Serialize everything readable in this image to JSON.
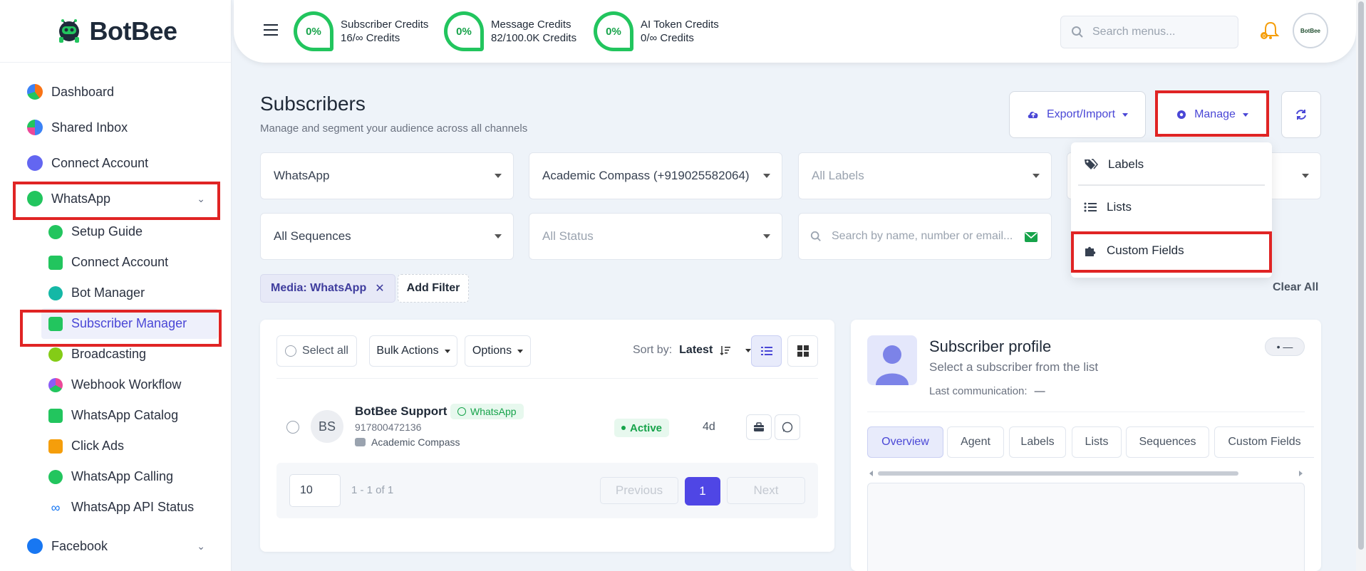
{
  "brand": {
    "name": "BotBee"
  },
  "sidebar": {
    "items": [
      {
        "label": "Dashboard",
        "color": "#f97316"
      },
      {
        "label": "Shared Inbox",
        "color": "#3b82f6"
      },
      {
        "label": "Connect Account",
        "color": "#6366f1"
      },
      {
        "label": "WhatsApp",
        "color": "#22c55e"
      }
    ],
    "whatsapp_sub": [
      {
        "label": "Setup Guide"
      },
      {
        "label": "Connect Account"
      },
      {
        "label": "Bot Manager"
      },
      {
        "label": "Subscriber Manager"
      },
      {
        "label": "Broadcasting"
      },
      {
        "label": "Webhook Workflow"
      },
      {
        "label": "WhatsApp Catalog"
      },
      {
        "label": "Click Ads"
      },
      {
        "label": "WhatsApp Calling"
      },
      {
        "label": "WhatsApp API Status"
      }
    ],
    "facebook": {
      "label": "Facebook"
    }
  },
  "topbar": {
    "credits": [
      {
        "percent": "0%",
        "title": "Subscriber Credits",
        "value": "16/∞ Credits"
      },
      {
        "percent": "0%",
        "title": "Message Credits",
        "value": "82/100.0K Credits"
      },
      {
        "percent": "0%",
        "title": "AI Token Credits",
        "value": "0/∞ Credits"
      }
    ],
    "search_placeholder": "Search menus...",
    "notification_count": "0",
    "avatar_text": "BotBee"
  },
  "header": {
    "title": "Subscribers",
    "subtitle": "Manage and segment your audience across all channels",
    "export_label": "Export/Import",
    "manage_label": "Manage"
  },
  "manage_menu": {
    "labels": "Labels",
    "lists": "Lists",
    "custom_fields": "Custom Fields"
  },
  "filters": {
    "channel": "WhatsApp",
    "account": "Academic Compass (+919025582064)",
    "labels": "All Labels",
    "sequences": "All Sequences",
    "status": "All Status",
    "search_placeholder": "Search by name, number or email..."
  },
  "active_filters": {
    "chip": "Media: WhatsApp",
    "add_filter": "Add Filter",
    "clear_all": "Clear All"
  },
  "list": {
    "select_all": "Select all",
    "bulk_actions": "Bulk Actions",
    "options": "Options",
    "sort_by_label": "Sort by:",
    "sort_value": "Latest",
    "rows": [
      {
        "initials": "BS",
        "name": "BotBee Support",
        "channel": "WhatsApp",
        "phone": "917800472136",
        "account": "Academic Compass",
        "status": "Active",
        "age": "4d"
      }
    ],
    "page_size": "10",
    "range": "1 - 1 of 1",
    "prev": "Previous",
    "page": "1",
    "next": "Next"
  },
  "profile": {
    "title": "Subscriber profile",
    "subtitle": "Select a subscriber from the list",
    "last_comm_label": "Last communication:",
    "last_comm_value": "—",
    "badge": "• —",
    "tabs": [
      "Overview",
      "Agent",
      "Labels",
      "Lists",
      "Sequences",
      "Custom Fields"
    ]
  }
}
